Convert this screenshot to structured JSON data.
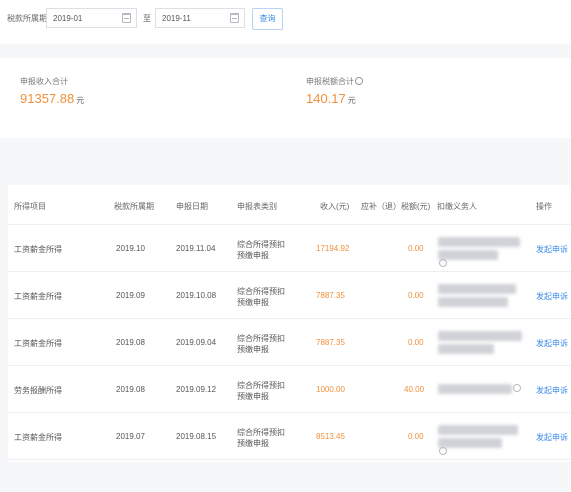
{
  "filter": {
    "period_label": "税款所属期",
    "start_value": "2019-01",
    "separator": "至",
    "end_value": "2019-11",
    "query_label": "查询"
  },
  "summary": {
    "income_label": "申报收入合计",
    "income_value": "91357.88",
    "income_unit": "元",
    "tax_label": "申报税额合计",
    "tax_value": "140.17",
    "tax_unit": "元"
  },
  "table": {
    "headers": [
      "所得项目",
      "税款所属期",
      "申报日期",
      "申报表类别",
      "收入(元)",
      "应补（退）税额(元)",
      "扣缴义务人",
      "操作"
    ],
    "rows": [
      {
        "item": "工资薪金所得",
        "period": "2019.10",
        "date": "2019.11.04",
        "type1": "综合所得预扣",
        "type2": "预缴申报",
        "income": "17194.92",
        "tax": "0.00",
        "action": "发起申诉"
      },
      {
        "item": "工资薪金所得",
        "period": "2019.09",
        "date": "2019.10.08",
        "type1": "综合所得预扣",
        "type2": "预缴申报",
        "income": "7887.35",
        "tax": "0.00",
        "action": "发起申诉"
      },
      {
        "item": "工资薪金所得",
        "period": "2019.08",
        "date": "2019.09.04",
        "type1": "综合所得预扣",
        "type2": "预缴申报",
        "income": "7887.35",
        "tax": "0.00",
        "action": "发起申诉"
      },
      {
        "item": "劳务报酬所得",
        "period": "2019.08",
        "date": "2019.09.12",
        "type1": "综合所得预扣",
        "type2": "预缴申报",
        "income": "1000.00",
        "tax": "40.00",
        "action": "发起申诉"
      },
      {
        "item": "工资薪金所得",
        "period": "2019.07",
        "date": "2019.08.15",
        "type1": "综合所得预扣",
        "type2": "预缴申报",
        "income": "8513.45",
        "tax": "0.00",
        "action": "发起申诉"
      }
    ]
  },
  "colors": {
    "accent_orange": "#f0903c",
    "link_blue": "#3b8bea"
  }
}
